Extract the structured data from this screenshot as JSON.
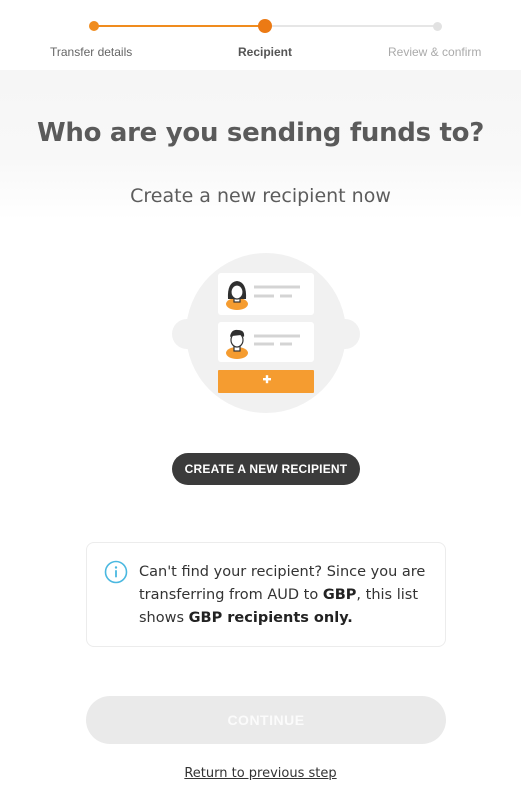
{
  "stepper": {
    "steps": [
      {
        "label": "Transfer details",
        "state": "done"
      },
      {
        "label": "Recipient",
        "state": "current"
      },
      {
        "label": "Review & confirm",
        "state": "upcoming"
      }
    ]
  },
  "header": {
    "title": "Who are you sending funds to?",
    "subtitle": "Create a new recipient now"
  },
  "illustration": {
    "icon": "recipients-illustration",
    "accent_color": "#f59c30"
  },
  "actions": {
    "create_label": "CREATE A NEW RECIPIENT",
    "continue_label": "CONTINUE",
    "back_label": "Return to previous step"
  },
  "info": {
    "icon": "info-icon",
    "text_part1": "Can't find your recipient? Since you are transferring from AUD to ",
    "currency": "GBP",
    "text_part2": ", this list shows ",
    "emphasis": "GBP recipients only."
  },
  "colors": {
    "accent": "#ec7a14",
    "dark_button": "#3b3b3b",
    "disabled_button": "#eaeaea"
  }
}
